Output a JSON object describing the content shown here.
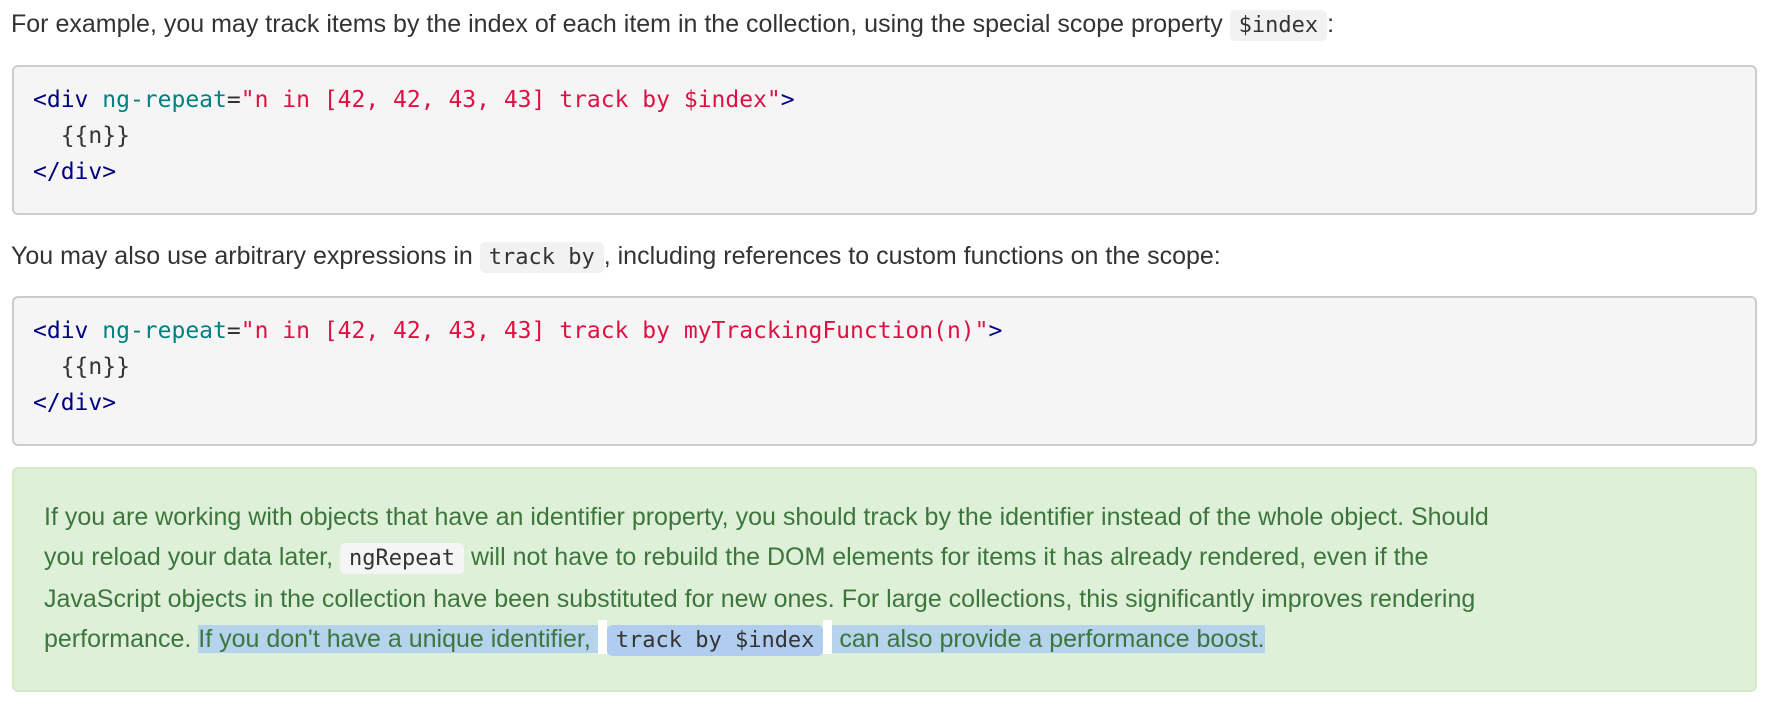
{
  "para1": {
    "text": "For example, you may track items by the index of each item in the collection, using the special scope property ",
    "code": "$index",
    "suffix": ":"
  },
  "code1": {
    "tag_open": "<div",
    "attr": "ng-repeat",
    "eq": "=",
    "value": "\"n in [42, 42, 43, 43] track by $index\"",
    "tag_close": ">",
    "body": "  {{n}}",
    "end_tag": "</div>"
  },
  "para2": {
    "text": "You may also use arbitrary expressions in ",
    "code": "track by",
    "suffix": ", including references to custom functions on the scope:"
  },
  "code2": {
    "tag_open": "<div",
    "attr": "ng-repeat",
    "eq": "=",
    "value": "\"n in [42, 42, 43, 43] track by myTrackingFunction(n)\"",
    "tag_close": ">",
    "body": "  {{n}}",
    "end_tag": "</div>"
  },
  "alert": {
    "line1": "If you are working with objects that have an identifier property, you should track by the identifier instead of the whole object. Should",
    "line2_a": "you reload your data later, ",
    "line2_code": "ngRepeat",
    "line2_b": " will not have to rebuild the DOM elements for items it has already rendered, even if the",
    "line3": "JavaScript objects in the collection have been substituted for new ones. For large collections, this significantly improves rendering",
    "line4_a": "performance. ",
    "line4_hl_a": "If you don't have a unique identifier, ",
    "line4_code": "track by $index",
    "line4_hl_b": " can also provide a performance boost."
  },
  "colors": {
    "alert_text": "#3c763d",
    "alert_bg": "#dff0d8",
    "selection": "#b5d4ec",
    "code_tag": "#000080",
    "code_attr": "#008080",
    "code_string": "#dd1144"
  }
}
